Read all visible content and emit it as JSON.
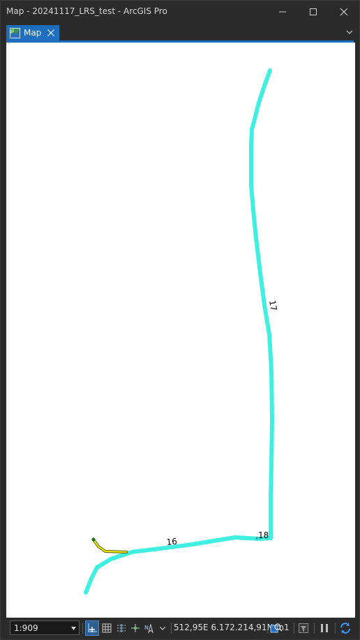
{
  "window": {
    "title": "Map - 20241117_LRS_test - ArcGIS Pro"
  },
  "tabs": [
    {
      "label": "Map",
      "active": true
    }
  ],
  "map": {
    "route_labels": [
      "17",
      "16",
      "18"
    ]
  },
  "statusbar": {
    "scale": "1:909",
    "coordinates": "512,95E 6.172.214,91N m",
    "selected_count": "1"
  },
  "colors": {
    "accent": "#1f6fc0",
    "route": "#3ff0e0",
    "selection": "#f0f000",
    "map_background": "#ffffff",
    "chrome": "#2b2b2b"
  },
  "icons": {
    "tab": "map-icon",
    "close": "close-icon",
    "minimize": "minimize-icon",
    "maximize": "maximize-icon",
    "overflow": "chevron-down-icon"
  }
}
